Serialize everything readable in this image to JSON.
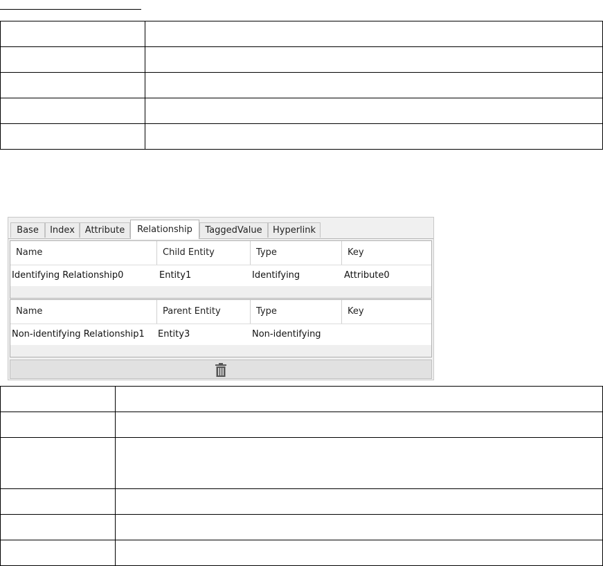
{
  "top_table": {
    "rows": 5
  },
  "bottom_table": {
    "rows": 6
  },
  "panel": {
    "tabs": [
      "Base",
      "Index",
      "Attribute",
      "Relationship",
      "TaggedValue",
      "Hyperlink"
    ],
    "active_tab": "Relationship",
    "child_section": {
      "headers": [
        "Name",
        "Child Entity",
        "Type",
        "Key"
      ],
      "row": [
        "Identifying Relationship0",
        "Entity1",
        "Identifying",
        "Attribute0"
      ]
    },
    "parent_section": {
      "headers": [
        "Name",
        "Parent Entity",
        "Type",
        "Key"
      ],
      "row": [
        "Non-identifying Relationship1",
        "Entity3",
        "Non-identifying",
        ""
      ]
    },
    "delete_icon": "trash-icon"
  }
}
